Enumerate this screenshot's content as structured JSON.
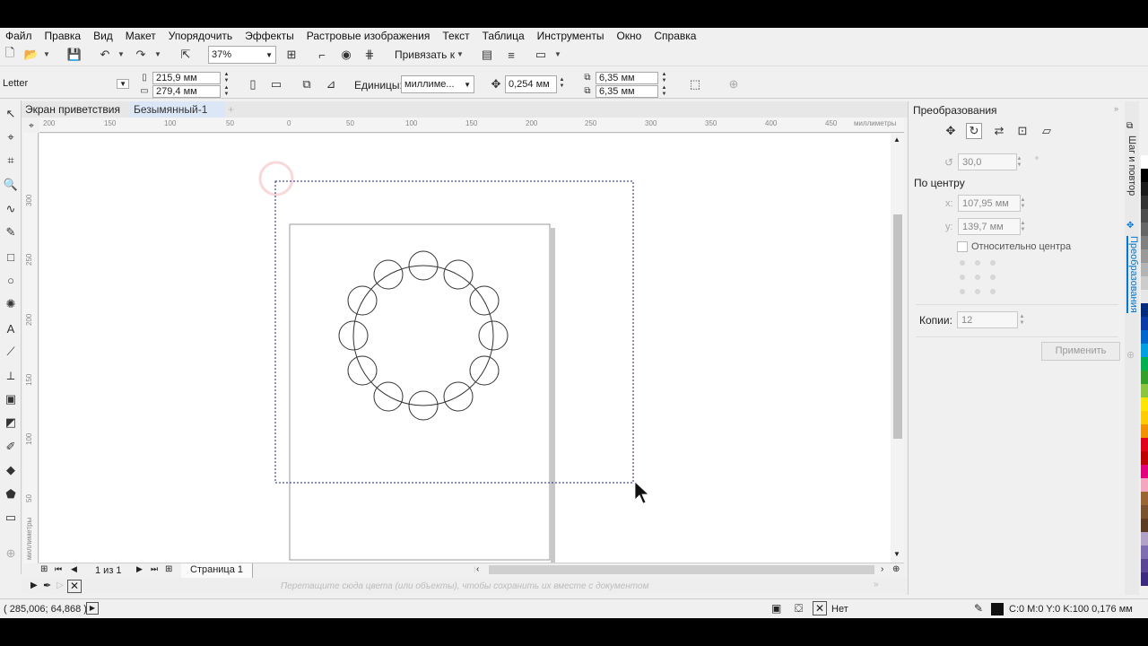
{
  "menu": [
    "Файл",
    "Правка",
    "Вид",
    "Макет",
    "Упорядочить",
    "Эффекты",
    "Растровые изображения",
    "Текст",
    "Таблица",
    "Инструменты",
    "Окно",
    "Справка"
  ],
  "toolbar": {
    "zoom": "37%",
    "snap_label": "Привязать к"
  },
  "propbar": {
    "paper": "Letter",
    "width": "215,9 мм",
    "height": "279,4 мм",
    "units_label": "Единицы:",
    "units_value": "миллиме...",
    "nudge": "0,254 мм",
    "dup_x": "6,35 мм",
    "dup_y": "6,35 мм"
  },
  "tabs": [
    "Экран приветствия",
    "Безымянный-1"
  ],
  "ruler": {
    "h_labels": [
      "200",
      "150",
      "100",
      "50",
      "0",
      "50",
      "100",
      "150",
      "200",
      "250",
      "300",
      "350",
      "400",
      "450"
    ],
    "h_unit": "миллиметры",
    "v_labels": [
      "300",
      "250",
      "200",
      "150",
      "100",
      "50"
    ],
    "v_unit": "миллиметры"
  },
  "pagenav": {
    "count": "1 из 1",
    "page_tab": "Страница 1"
  },
  "colorbar": {
    "hint": "Перетащите сюда цвета (или объекты), чтобы сохранить их вместе с документом"
  },
  "status": {
    "coords": "( 285,006; 64,868 )",
    "fill_label": "Нет",
    "outline": "C:0 M:0 Y:0 K:100  0,176 мм"
  },
  "panel": {
    "title": "Преобразования",
    "angle": "30,0",
    "degree_sign": "°",
    "center_label": "По центру",
    "x_label": "x:",
    "x_value": "107,95 мм",
    "y_label": "y:",
    "y_value": "139,7 мм",
    "relative_label": "Относительно центра",
    "copies_label": "Копии:",
    "copies_value": "12",
    "apply_label": "Применить"
  },
  "sidetabs": [
    "Шаг и повтор",
    "Преобразования"
  ],
  "palette": [
    "#ffffff",
    "#000000",
    "#1a1a1a",
    "#333333",
    "#4d4d4d",
    "#666666",
    "#808080",
    "#999999",
    "#b3b3b3",
    "#cccccc",
    "#e6e6e6",
    "#002a7a",
    "#0b3da8",
    "#0066cc",
    "#00a0e0",
    "#00b050",
    "#33a02c",
    "#8cc63f",
    "#ffe600",
    "#ffcc00",
    "#f39200",
    "#e2001a",
    "#c00000",
    "#e4007d",
    "#f6a5c0",
    "#996633",
    "#7a5230",
    "#5c3d23",
    "#b3a2c7",
    "#7f6fb0",
    "#5b4597",
    "#3b2a80"
  ],
  "colors": {
    "accent": "#0078d7",
    "selection": "#1a237e"
  }
}
